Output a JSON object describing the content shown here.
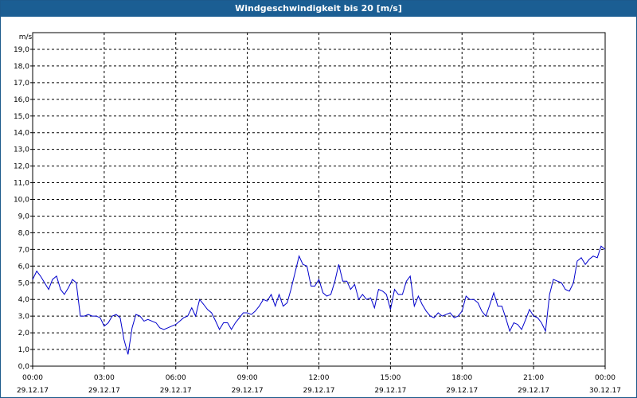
{
  "window": {
    "title": "Windgeschwindigkeit bis 20 [m/s]"
  },
  "chart_data": {
    "type": "line",
    "title": "Windgeschwindigkeit bis 20 [m/s]",
    "ylabel": "m/s",
    "ylim": [
      0,
      20
    ],
    "y_ticks": [
      "0,0",
      "1,0",
      "2,0",
      "3,0",
      "4,0",
      "5,0",
      "6,0",
      "7,0",
      "8,0",
      "9,0",
      "10,0",
      "11,0",
      "12,0",
      "13,0",
      "14,0",
      "15,0",
      "16,0",
      "17,0",
      "18,0",
      "19,0"
    ],
    "x_range_hours": [
      0,
      24
    ],
    "x_ticks": [
      {
        "hour": 0,
        "time": "00:00",
        "date": "29.12.17"
      },
      {
        "hour": 3,
        "time": "03:00",
        "date": "29.12.17"
      },
      {
        "hour": 6,
        "time": "06:00",
        "date": "29.12.17"
      },
      {
        "hour": 9,
        "time": "09:00",
        "date": "29.12.17"
      },
      {
        "hour": 12,
        "time": "12:00",
        "date": "29.12.17"
      },
      {
        "hour": 15,
        "time": "15:00",
        "date": "29.12.17"
      },
      {
        "hour": 18,
        "time": "18:00",
        "date": "29.12.17"
      },
      {
        "hour": 21,
        "time": "21:00",
        "date": "29.12.17"
      },
      {
        "hour": 24,
        "time": "00:00",
        "date": "30.12.17"
      }
    ],
    "grid": true,
    "line_color": "#0000cc",
    "series": [
      {
        "x": [
          0.0,
          0.17,
          0.33,
          0.5,
          0.67,
          0.83,
          1.0,
          1.17,
          1.33,
          1.5,
          1.67,
          1.83,
          2.0,
          2.17,
          2.33,
          2.5,
          2.67,
          2.83,
          3.0,
          3.17,
          3.33,
          3.5,
          3.67,
          3.83,
          4.0,
          4.17,
          4.33,
          4.5,
          4.67,
          4.83,
          5.0,
          5.17,
          5.33,
          5.5,
          5.67,
          5.83,
          6.0,
          6.17,
          6.33,
          6.5,
          6.67,
          6.83,
          7.0,
          7.17,
          7.33,
          7.5,
          7.67,
          7.83,
          8.0,
          8.17,
          8.33,
          8.5,
          8.67,
          8.83,
          9.0,
          9.17,
          9.33,
          9.5,
          9.67,
          9.83,
          10.0,
          10.17,
          10.33,
          10.5,
          10.67,
          10.83,
          11.0,
          11.17,
          11.33,
          11.5,
          11.67,
          11.83,
          12.0,
          12.17,
          12.33,
          12.5,
          12.67,
          12.83,
          13.0,
          13.17,
          13.33,
          13.5,
          13.67,
          13.83,
          14.0,
          14.17,
          14.33,
          14.5,
          14.67,
          14.83,
          15.0,
          15.17,
          15.33,
          15.5,
          15.67,
          15.83,
          16.0,
          16.17,
          16.33,
          16.5,
          16.67,
          16.83,
          17.0,
          17.17,
          17.33,
          17.5,
          17.67,
          17.83,
          18.0,
          18.17,
          18.33,
          18.5,
          18.67,
          18.83,
          19.0,
          19.17,
          19.33,
          19.5,
          19.67,
          19.83,
          20.0,
          20.17,
          20.33,
          20.5,
          20.67,
          20.83,
          21.0,
          21.17,
          21.33,
          21.5,
          21.67,
          21.83,
          22.0,
          22.17,
          22.33,
          22.5,
          22.67,
          22.83,
          23.0,
          23.17,
          23.33,
          23.5,
          23.67,
          23.83,
          24.0
        ],
        "y": [
          5.2,
          5.7,
          5.4,
          5.0,
          4.6,
          5.2,
          5.4,
          4.6,
          4.3,
          4.7,
          5.2,
          5.0,
          3.0,
          3.0,
          3.1,
          3.0,
          3.0,
          2.9,
          2.4,
          2.6,
          3.0,
          3.1,
          2.9,
          1.6,
          0.7,
          2.3,
          3.1,
          3.0,
          2.7,
          2.8,
          2.7,
          2.6,
          2.3,
          2.2,
          2.3,
          2.4,
          2.5,
          2.7,
          2.9,
          3.0,
          3.5,
          3.0,
          4.0,
          3.7,
          3.4,
          3.2,
          2.7,
          2.2,
          2.6,
          2.6,
          2.2,
          2.6,
          2.9,
          3.2,
          3.2,
          3.1,
          3.3,
          3.6,
          4.0,
          3.9,
          4.3,
          3.6,
          4.3,
          3.6,
          3.8,
          4.6,
          5.6,
          6.6,
          6.1,
          6.0,
          4.8,
          4.8,
          5.2,
          4.4,
          4.2,
          4.3,
          5.1,
          6.1,
          5.1,
          5.1,
          4.6,
          4.9,
          4.0,
          4.3,
          4.0,
          4.1,
          3.5,
          4.6,
          4.5,
          4.3,
          3.4,
          4.6,
          4.3,
          4.3,
          5.1,
          5.4,
          3.6,
          4.2,
          3.7,
          3.3,
          3.0,
          2.9,
          3.2,
          3.0,
          3.1,
          3.2,
          2.9,
          3.0,
          3.3,
          4.2,
          4.0,
          4.0,
          3.8,
          3.3,
          3.0,
          3.7,
          4.4,
          3.6,
          3.6,
          2.9,
          2.1,
          2.6,
          2.5,
          2.2,
          2.8,
          3.4,
          3.0,
          2.9,
          2.6,
          2.1,
          4.3,
          5.2,
          5.1,
          5.0,
          4.6,
          4.5,
          5.0,
          6.3,
          6.5,
          6.1,
          6.4,
          6.6,
          6.5,
          7.2,
          7.0
        ]
      }
    ]
  }
}
